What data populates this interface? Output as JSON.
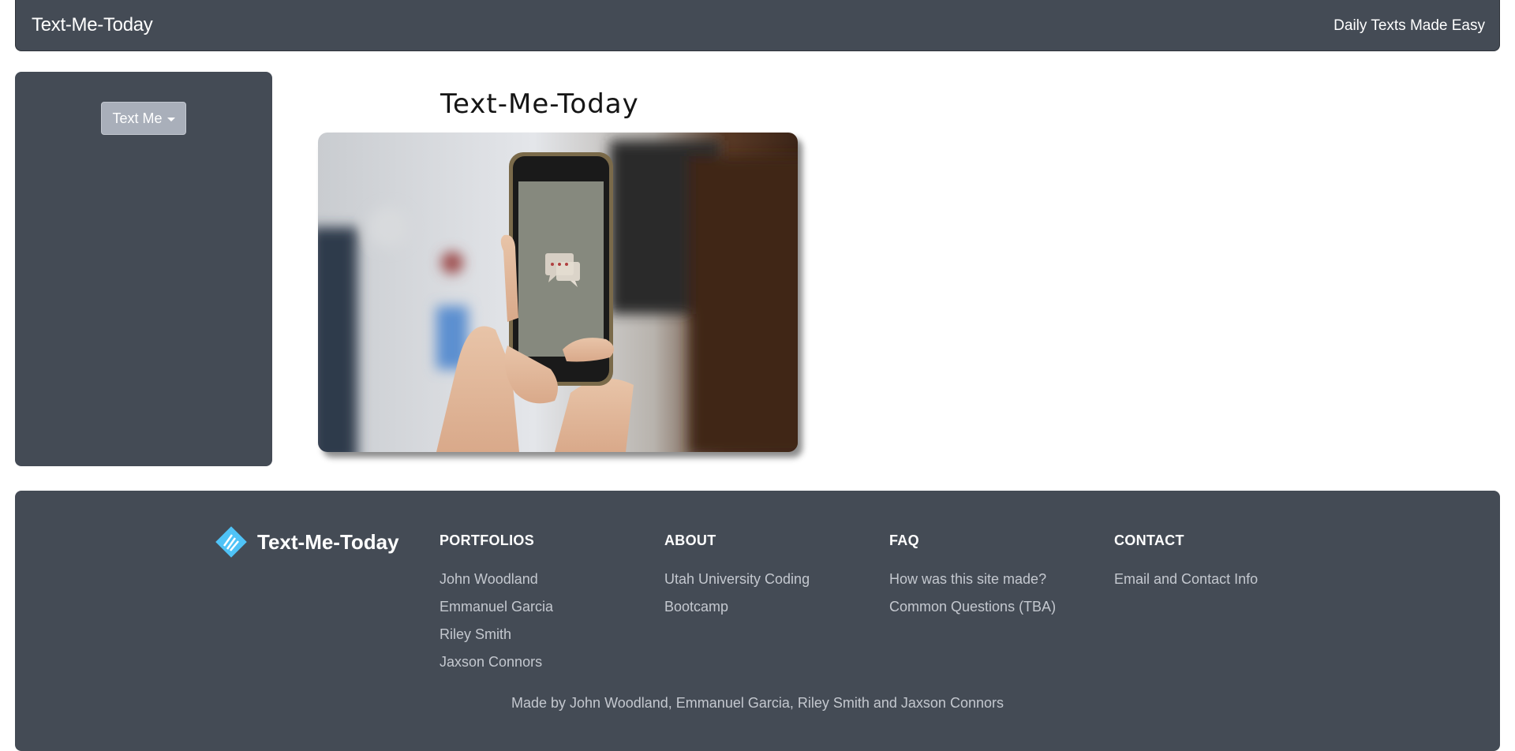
{
  "navbar": {
    "brand": "Text-Me-Today",
    "tagline": "Daily Texts Made Easy"
  },
  "sidebar": {
    "dropdown_label": "Text Me"
  },
  "hero": {
    "title": "Text-Me-Today",
    "image_alt": "hands holding phone with chat bubbles icon"
  },
  "footer": {
    "logo_text": "Text-Me-Today",
    "columns": [
      {
        "heading": "PORTFOLIOS",
        "links": [
          "John Woodland",
          "Emmanuel Garcia",
          "Riley Smith",
          "Jaxson Connors"
        ]
      },
      {
        "heading": "ABOUT",
        "links": [
          "Utah University Coding",
          "Bootcamp"
        ]
      },
      {
        "heading": "FAQ",
        "links": [
          "How was this site made?",
          "Common Questions (TBA)"
        ]
      },
      {
        "heading": "CONTACT",
        "links": [
          "Email and Contact Info"
        ]
      }
    ],
    "credit": "Made by John Woodland, Emmanuel Garcia, Riley Smith and Jaxson Connors"
  },
  "colors": {
    "panel": "#444b55",
    "button": "#a9afba",
    "footer_link": "#c4c8cf",
    "logo_accent": "#4fc3f7"
  }
}
